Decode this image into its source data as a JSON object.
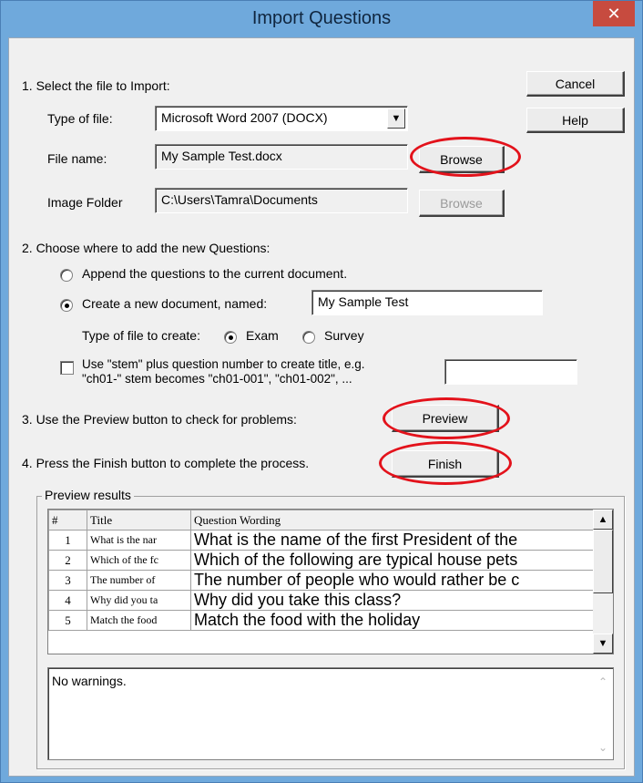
{
  "window": {
    "title": "Import Questions",
    "close_glyph": "✕"
  },
  "buttons": {
    "cancel": "Cancel",
    "help": "Help",
    "browse": "Browse",
    "browse_image": "Browse",
    "preview": "Preview",
    "finish": "Finish"
  },
  "step1": {
    "heading": "1.  Select the file to Import:",
    "type_label": "Type of file:",
    "type_value": "Microsoft Word 2007 (DOCX)",
    "filename_label": "File name:",
    "filename_value": "My Sample Test.docx",
    "image_folder_label": "Image Folder",
    "image_folder_value": "C:\\Users\\Tamra\\Documents"
  },
  "step2": {
    "heading": "2.  Choose where to add the new Questions:",
    "append_label": "Append the questions to the current document.",
    "create_label": "Create a new document, named:",
    "create_name_value": "My Sample Test",
    "filetype_label": "Type of file to create:",
    "exam_label": "Exam",
    "survey_label": "Survey",
    "stem_line1": "Use \"stem\" plus question number to create title,  e.g.",
    "stem_line2": "\"ch01-\" stem becomes \"ch01-001\",  \"ch01-002\",  ...",
    "stem_value": ""
  },
  "step3": {
    "text": "3.  Use the Preview button to check for problems:"
  },
  "step4": {
    "text": "4.  Press the Finish button to complete the process."
  },
  "preview": {
    "group_title": "Preview results",
    "columns": [
      "#",
      "Title",
      "Question Wording"
    ],
    "rows": [
      {
        "num": "1",
        "title": "What is the nar",
        "wording": "What is the name of the first President of the"
      },
      {
        "num": "2",
        "title": "Which of the fc",
        "wording": "Which of the following are typical house pets"
      },
      {
        "num": "3",
        "title": "The number of",
        "wording": "The number of people who would rather be c"
      },
      {
        "num": "4",
        "title": "Why did you ta",
        "wording": "Why did you take this class?"
      },
      {
        "num": "5",
        "title": "Match the food",
        "wording": "Match the food with the holiday"
      }
    ],
    "warnings": "No warnings."
  },
  "colors": {
    "titlebar": "#6fa9dc",
    "close": "#c74b3f",
    "highlight_circle": "#e3121b",
    "dialog_bg": "#f0f0f0"
  },
  "icons": {
    "close": "close-icon",
    "dropdown": "chevron-down-icon",
    "scroll_up": "scroll-up-icon",
    "scroll_down": "scroll-down-icon"
  }
}
